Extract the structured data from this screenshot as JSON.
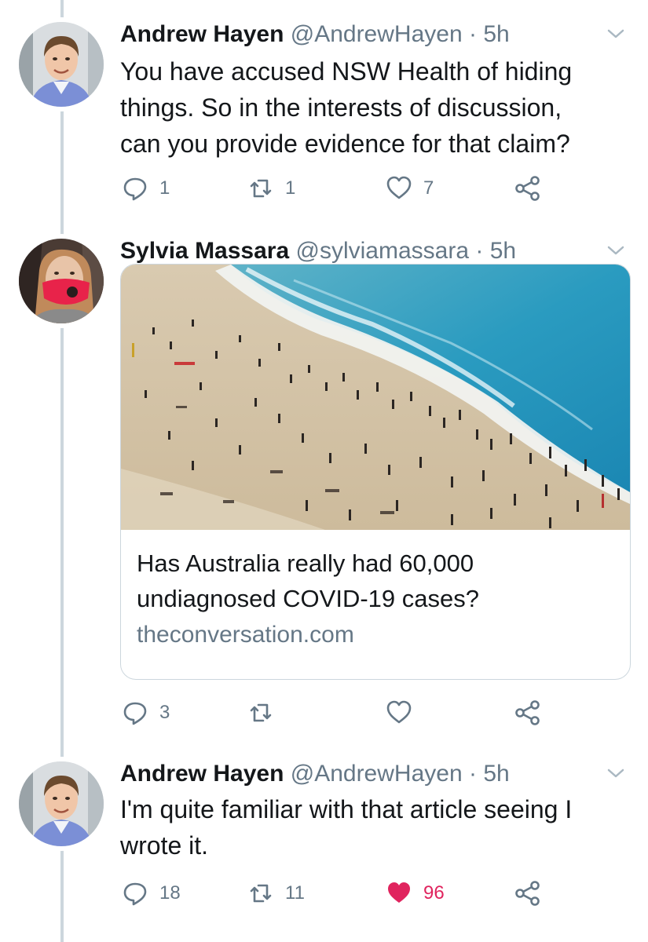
{
  "colors": {
    "text_primary": "#14171a",
    "text_secondary": "#657786",
    "border": "#ccd6dd",
    "like_active": "#e0245e"
  },
  "tweets": [
    {
      "author_name": "Andrew Hayen",
      "handle": "@AndrewHayen",
      "separator": "·",
      "time": "5h",
      "avatar_icon": "avatar-man-icon",
      "text_lines": [
        "You have accused NSW Health of hiding",
        "things. So in the interests of discussion,",
        "can you provide evidence for that claim?"
      ],
      "replies": "1",
      "retweets": "1",
      "likes": "7",
      "liked": false
    },
    {
      "author_name": "Sylvia Massara",
      "handle": "@sylviamassara",
      "separator": "·",
      "time": "5h",
      "avatar_icon": "avatar-woman-mask-icon",
      "card": {
        "image_icon": "beach-crowd-photo",
        "title_lines": [
          "Has Australia really had 60,000",
          "undiagnosed COVID-19 cases?"
        ],
        "domain": "theconversation.com"
      },
      "replies": "3",
      "retweets": "",
      "likes": "",
      "liked": false
    },
    {
      "author_name": "Andrew Hayen",
      "handle": "@AndrewHayen",
      "separator": "·",
      "time": "5h",
      "avatar_icon": "avatar-man-icon",
      "text_lines": [
        "I'm quite familiar with that article seeing I",
        "wrote it."
      ],
      "replies": "18",
      "retweets": "11",
      "likes": "96",
      "liked": true
    }
  ]
}
